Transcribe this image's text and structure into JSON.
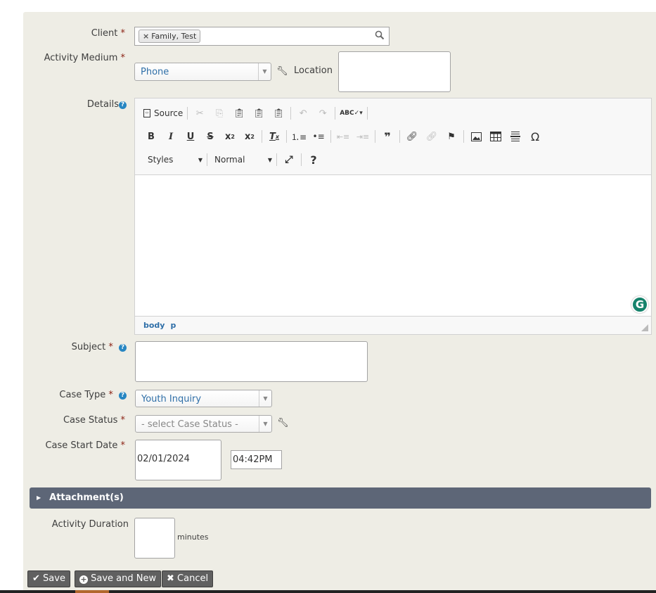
{
  "form": {
    "client": {
      "label": "Client",
      "required_mark": "*",
      "tag": "Family, Test",
      "remove_glyph": "×"
    },
    "activity_medium": {
      "label": "Activity Medium",
      "required_mark": "*",
      "value": "Phone"
    },
    "location": {
      "label": "Location",
      "value": ""
    },
    "details": {
      "label": "Details",
      "toolbar": {
        "source_label": "Source",
        "styles_label": "Styles",
        "format_label": "Normal"
      },
      "path": [
        "body",
        "p"
      ],
      "grammarly_glyph": "G"
    },
    "subject": {
      "label": "Subject",
      "required_mark": "*",
      "value": ""
    },
    "case_type": {
      "label": "Case Type",
      "required_mark": "*",
      "value": "Youth Inquiry"
    },
    "case_status": {
      "label": "Case Status",
      "required_mark": "*",
      "placeholder": "- select Case Status -"
    },
    "case_start_date": {
      "label": "Case Start Date",
      "required_mark": "*",
      "date": "02/01/2024",
      "time": "04:42PM"
    },
    "attachments": {
      "label": "Attachment(s)"
    },
    "activity_duration": {
      "label": "Activity Duration",
      "value": "",
      "unit": "minutes"
    }
  },
  "buttons": {
    "save": "Save",
    "save_and_new": "Save and New",
    "cancel": "Cancel"
  }
}
